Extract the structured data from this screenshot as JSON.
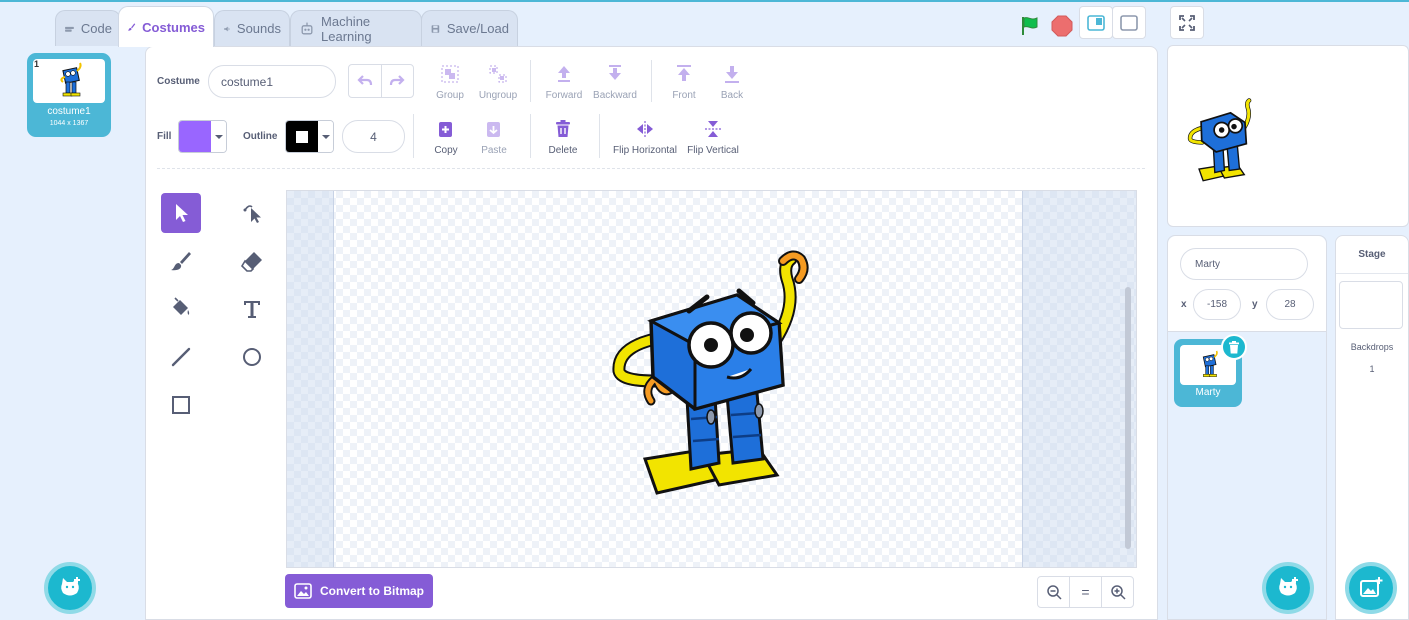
{
  "tabs": [
    {
      "label": "Code",
      "icon": "code-icon"
    },
    {
      "label": "Costumes",
      "icon": "brush-icon"
    },
    {
      "label": "Sounds",
      "icon": "speaker-icon"
    },
    {
      "label": "Machine Learning",
      "icon": "robot-icon"
    },
    {
      "label": "Save/Load",
      "icon": "floppy-icon"
    }
  ],
  "costume_list": [
    {
      "number": "1",
      "name": "costume1",
      "size": "1044 x 1367"
    }
  ],
  "editor": {
    "costume_label": "Costume",
    "costume_name": "costume1",
    "fill_label": "Fill",
    "fill_color": "#9966ff",
    "outline_label": "Outline",
    "outline_color": "#000000",
    "outline_width": "4",
    "toolbar_row1": [
      "Group",
      "Ungroup",
      "Forward",
      "Backward",
      "Front",
      "Back"
    ],
    "toolbar_row2": [
      "Copy",
      "Paste",
      "Delete",
      "Flip Horizontal",
      "Flip Vertical"
    ],
    "convert_button": "Convert to Bitmap",
    "zoom": [
      "-",
      "=",
      "+"
    ]
  },
  "sprite_info": {
    "name": "Marty",
    "x_label": "x",
    "x": "-158",
    "y_label": "y",
    "y": "28"
  },
  "sprites": [
    {
      "name": "Marty"
    }
  ],
  "stage_panel": {
    "title": "Stage",
    "backdrops_label": "Backdrops",
    "backdrops_count": "1"
  },
  "colors": {
    "accent": "#855cd6",
    "teal": "#4cb7d6",
    "green_flag": "#0fbd4c",
    "stop": "#ec6e6e"
  }
}
